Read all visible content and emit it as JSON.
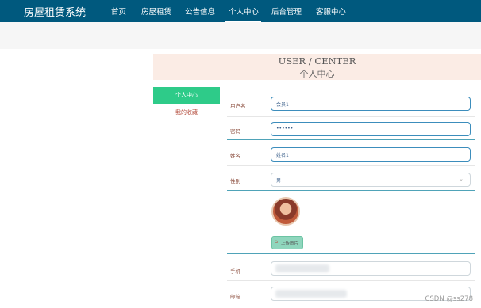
{
  "nav": {
    "brand": "房屋租赁系统",
    "items": [
      "首页",
      "房屋租赁",
      "公告信息",
      "个人中心",
      "后台管理",
      "客服中心"
    ],
    "active": "个人中心"
  },
  "header": {
    "title_en": "USER / CENTER",
    "title_cn": "个人中心"
  },
  "sidebar": {
    "items": [
      {
        "label": "个人中心",
        "active": true
      },
      {
        "label": "我的收藏",
        "active": false
      }
    ]
  },
  "form": {
    "username": {
      "label": "用户名",
      "value": "会员1"
    },
    "password": {
      "label": "密码",
      "value": "••••••"
    },
    "name": {
      "label": "姓名",
      "value": "姓名1"
    },
    "gender": {
      "label": "性别",
      "value": "男"
    },
    "upload_label": "上传图片",
    "phone": {
      "label": "手机"
    },
    "email": {
      "label": "邮箱"
    }
  },
  "watermark": "CSDN @ss278",
  "colors": {
    "nav_bg": "#00597e",
    "accent_green": "#2ecb89",
    "header_bg": "#fbece5",
    "field_border": "#3c8dbc"
  },
  "icons": {
    "upload": "home-icon",
    "select": "chevron-down-icon"
  }
}
